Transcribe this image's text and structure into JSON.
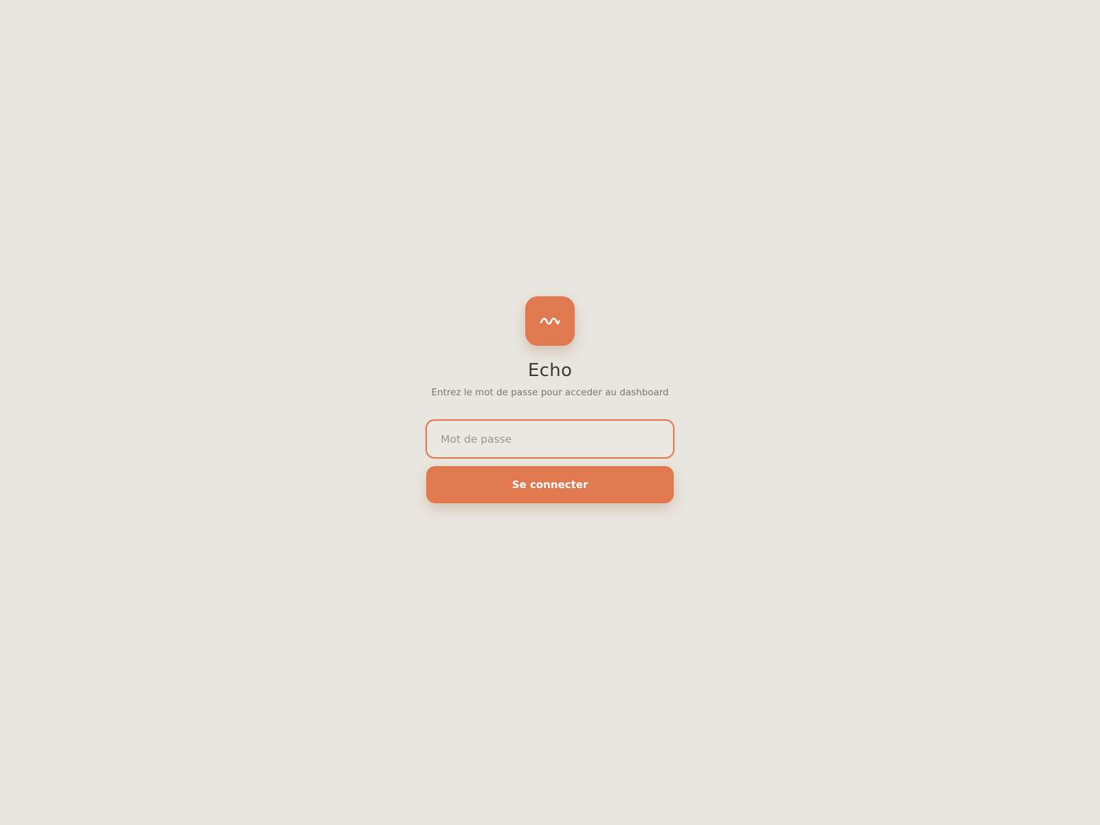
{
  "app": {
    "title": "Echo",
    "subtitle": "Entrez le mot de passe pour acceder au dashboard",
    "logo_icon": "wave-icon"
  },
  "form": {
    "password_placeholder": "Mot de passe",
    "password_value": "",
    "submit_label": "Se connecter"
  },
  "colors": {
    "background": "#E9E6DF",
    "accent": "#E07850",
    "text": "#3B3A35",
    "muted_text": "#7A7670"
  }
}
